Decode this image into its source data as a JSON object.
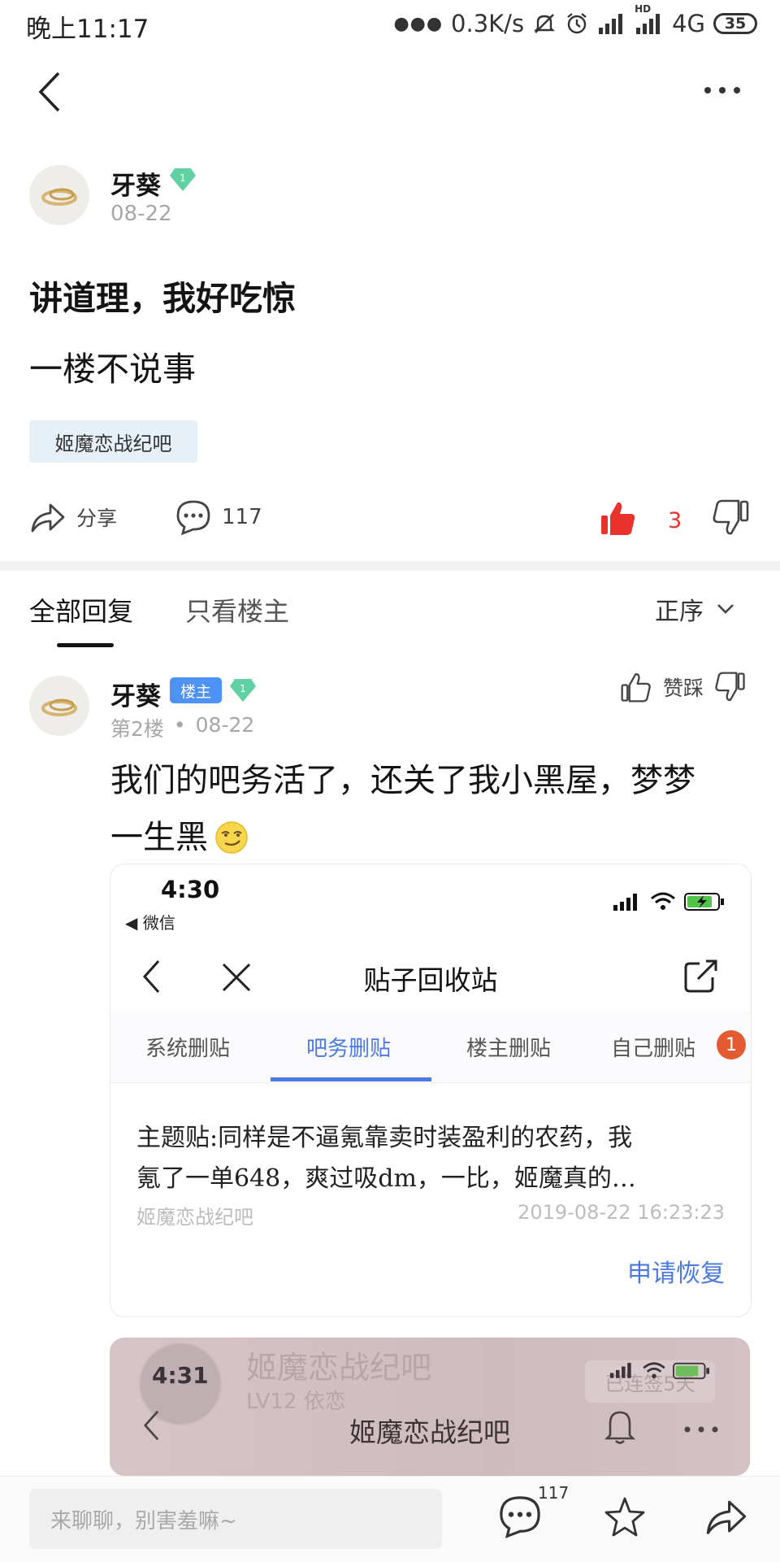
{
  "status_bar": {
    "time": "晚上11:17",
    "net_speed": "0.3K/s",
    "network": "4G",
    "hd": "HD",
    "battery": "35"
  },
  "post": {
    "author": "牙葵",
    "level": "1",
    "date": "08-22",
    "title": "讲道理，我好吃惊",
    "body": "一楼不说事",
    "forum_tag": "姬魔恋战纪吧",
    "share_label": "分享",
    "comment_count": "117",
    "like_count": "3"
  },
  "tabs": {
    "all": "全部回复",
    "op_only": "只看楼主",
    "sort": "正序"
  },
  "reply": {
    "author": "牙葵",
    "badge": "楼主",
    "level": "1",
    "floor": "第2楼",
    "separator": "•",
    "date": "08-22",
    "vote_label": "赞踩",
    "text_line1": "我们的吧务活了，还关了我小黑屋，梦梦",
    "text_line2": "一生黑",
    "emoji": "😏"
  },
  "embedded1": {
    "time": "4:30",
    "back_app": "◀ 微信",
    "title": "贴子回收站",
    "tabs": [
      "系统删贴",
      "吧务删贴",
      "楼主删贴",
      "自己删贴"
    ],
    "badge": "1",
    "content_line1": "主题贴:同样是不逼氪靠卖时装盈利的农药，我",
    "content_line2": "氪了一单648，爽过吸dm，一比，姬魔真的…",
    "forum": "姬魔恋战纪吧",
    "timestamp": "2019-08-22 16:23:23",
    "restore": "申请恢复"
  },
  "embedded2": {
    "bg_forum": "姬魔恋战纪吧",
    "bg_level": "LV12 依恋",
    "time": "4:31",
    "title": "姬魔恋战纪吧",
    "signin": "已连签5天"
  },
  "bottom": {
    "placeholder": "来聊聊，别害羞嘛~",
    "comment_count": "117"
  }
}
